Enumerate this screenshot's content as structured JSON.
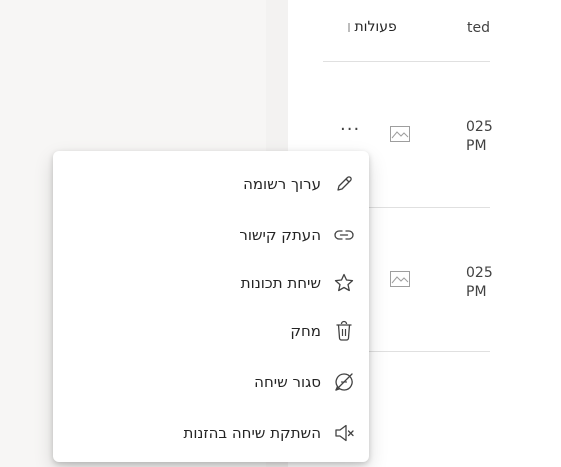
{
  "table": {
    "header": {
      "actions_label": "פעולות",
      "created_label": "ted"
    },
    "rows": [
      {
        "date_line1": "025",
        "date_line2": "PM"
      },
      {
        "date_line1": "025",
        "date_line2": "PM"
      }
    ]
  },
  "menu": {
    "items": [
      {
        "label": "ערוך רשומה",
        "icon": "pencil-icon"
      },
      {
        "label": "העתק קישור",
        "icon": "link-icon"
      },
      {
        "label": "שיחת תכונות",
        "icon": "star-icon"
      },
      {
        "label": "מחק",
        "icon": "trash-icon"
      },
      {
        "label": "סגור שיחה",
        "icon": "close-chat-icon"
      },
      {
        "label": "השתקת שיחה בהזנות",
        "icon": "mute-speaker-icon"
      }
    ]
  },
  "colors": {
    "text": "#242424",
    "icon": "#424242",
    "divider": "#e0e0e0"
  }
}
